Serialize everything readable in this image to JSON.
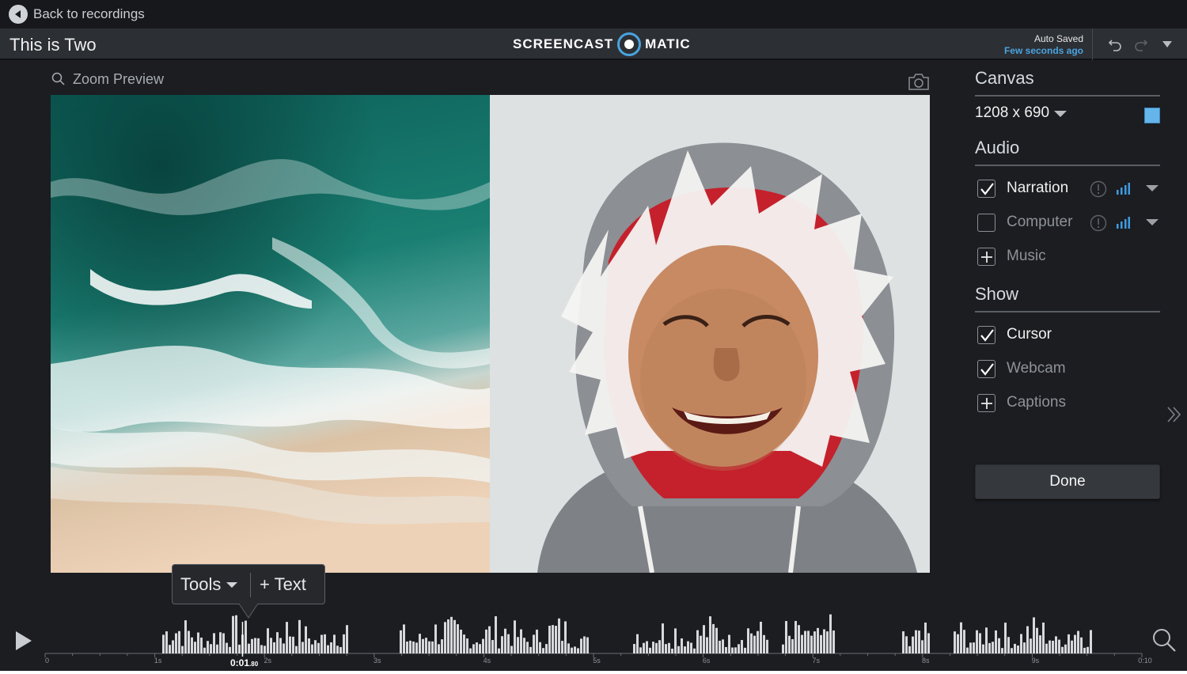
{
  "header": {
    "back_label": "Back to recordings",
    "project_title": "This is Two",
    "logo_left": "SCREENCAST",
    "logo_right": "MATIC",
    "save_status": "Auto Saved",
    "save_time": "Few seconds ago",
    "undo_icon": "undo-icon",
    "redo_icon": "redo-icon",
    "menu_icon": "chevron-down-icon"
  },
  "preview": {
    "zoom_label": "Zoom Preview",
    "zoom_icon": "search-icon",
    "snapshot_icon": "camera-icon",
    "left_image": "aerial ocean waves on beach",
    "right_image": "smiling child in shark hoodie"
  },
  "side_panel": {
    "canvas": {
      "heading": "Canvas",
      "size": "1208 x 690",
      "color": "#66b5ea"
    },
    "audio": {
      "heading": "Audio",
      "items": [
        {
          "label": "Narration",
          "checked": true
        },
        {
          "label": "Computer",
          "checked": false
        },
        {
          "label": "Music"
        }
      ]
    },
    "show": {
      "heading": "Show",
      "items": [
        {
          "label": "Cursor",
          "checked": true
        },
        {
          "label": "Webcam",
          "checked": true
        },
        {
          "label": "Captions"
        }
      ]
    },
    "done_label": "Done"
  },
  "tools_popup": {
    "tools_label": "Tools",
    "text_label": "+ Text"
  },
  "timeline": {
    "current_time": "0:01",
    "current_time_ms": ".80",
    "position_seconds": 1.8,
    "duration_seconds": 10,
    "tick_labels": [
      "0",
      "1s",
      "2s",
      "3s",
      "4s",
      "5s",
      "6s",
      "7s",
      "8s",
      "9s",
      "0:10"
    ],
    "accent": "#4aa3df"
  }
}
